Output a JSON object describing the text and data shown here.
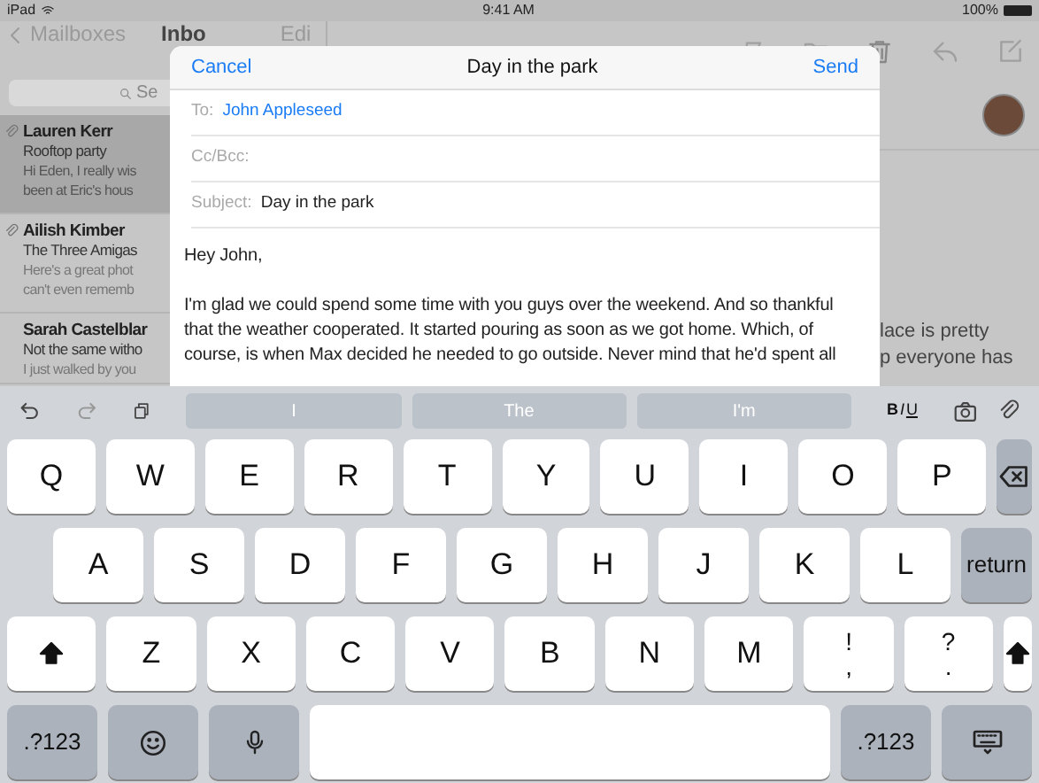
{
  "status_bar": {
    "device": "iPad",
    "time": "9:41 AM",
    "battery": "100%"
  },
  "mail_list": {
    "back": "Mailboxes",
    "title": "Inbo",
    "edit": "Edi",
    "search_placeholder": "Se",
    "messages": [
      {
        "sender": "Lauren Kerr",
        "subject": "Rooftop party",
        "preview": [
          "Hi Eden, I really wis",
          "been at Eric's hous"
        ],
        "selected": true,
        "attachment": true
      },
      {
        "sender": "Ailish Kimber",
        "subject": "The Three Amigas",
        "preview": [
          "Here's a great phot",
          "can't even rememb"
        ],
        "selected": false,
        "attachment": true
      },
      {
        "sender": "Sarah Castelblar",
        "subject": "Not the same witho",
        "preview": [
          "I just walked by you"
        ],
        "selected": false,
        "attachment": false
      }
    ]
  },
  "message_view": {
    "body_lines": [
      "lace is pretty",
      "p everyone has"
    ]
  },
  "compose": {
    "cancel": "Cancel",
    "title": "Day in the park",
    "send": "Send",
    "fields": [
      {
        "label": "To:",
        "value": "John Appleseed",
        "kind": "recipient"
      },
      {
        "label": "Cc/Bcc:"
      },
      {
        "label": "Subject:",
        "value": "Day in the park",
        "kind": "plain"
      }
    ],
    "body": [
      "Hey John,",
      "I'm glad we could spend some time with you guys over the weekend. And so thankful that the weather cooperated. It started pouring as soon as we got home. Which, of course, is when Max decided he needed to go outside. Never mind that he'd spent all"
    ]
  },
  "keyboard": {
    "suggestions": [
      "I",
      "The",
      "I'm"
    ],
    "format": [
      "B",
      "I",
      "U"
    ],
    "rows": [
      [
        {
          "kind": "letter",
          "label": "Q"
        },
        {
          "kind": "letter",
          "label": "W"
        },
        {
          "kind": "letter",
          "label": "E"
        },
        {
          "kind": "letter",
          "label": "R"
        },
        {
          "kind": "letter",
          "label": "T"
        },
        {
          "kind": "letter",
          "label": "Y"
        },
        {
          "kind": "letter",
          "label": "U"
        },
        {
          "kind": "letter",
          "label": "I"
        },
        {
          "kind": "letter",
          "label": "O"
        },
        {
          "kind": "letter",
          "label": "P"
        },
        {
          "kind": "delete"
        }
      ],
      [
        {
          "kind": "letter",
          "label": "A"
        },
        {
          "kind": "letter",
          "label": "S"
        },
        {
          "kind": "letter",
          "label": "D"
        },
        {
          "kind": "letter",
          "label": "F"
        },
        {
          "kind": "letter",
          "label": "G"
        },
        {
          "kind": "letter",
          "label": "H"
        },
        {
          "kind": "letter",
          "label": "J"
        },
        {
          "kind": "letter",
          "label": "K"
        },
        {
          "kind": "letter",
          "label": "L"
        },
        {
          "kind": "return",
          "label": "return"
        }
      ],
      [
        {
          "kind": "shift"
        },
        {
          "kind": "letter",
          "label": "Z"
        },
        {
          "kind": "letter",
          "label": "X"
        },
        {
          "kind": "letter",
          "label": "C"
        },
        {
          "kind": "letter",
          "label": "V"
        },
        {
          "kind": "letter",
          "label": "B"
        },
        {
          "kind": "letter",
          "label": "N"
        },
        {
          "kind": "letter",
          "label": "M"
        },
        {
          "kind": "dual",
          "top": "!",
          "bottom": ","
        },
        {
          "kind": "dual",
          "top": "?",
          "bottom": "."
        },
        {
          "kind": "shift"
        }
      ],
      [
        {
          "kind": "symbols",
          "label": ".?123"
        },
        {
          "kind": "emoji"
        },
        {
          "kind": "mic"
        },
        {
          "kind": "space"
        },
        {
          "kind": "symbols",
          "label": ".?123"
        },
        {
          "kind": "hide"
        }
      ]
    ]
  }
}
